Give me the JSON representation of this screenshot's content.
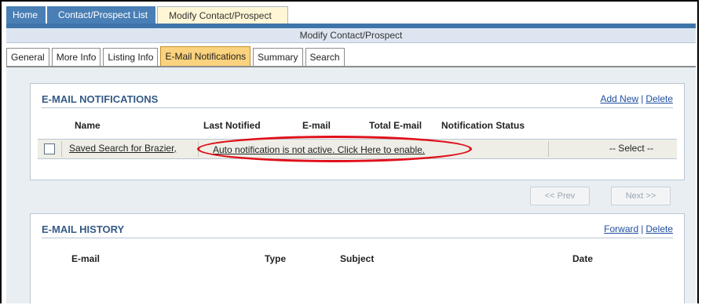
{
  "breadcrumbs": [
    {
      "label": "Home"
    },
    {
      "label": "Contact/Prospect List"
    },
    {
      "label": "Modify Contact/Prospect"
    }
  ],
  "section_title": "Modify Contact/Prospect",
  "tabs": [
    {
      "label": "General"
    },
    {
      "label": "More Info"
    },
    {
      "label": "Listing Info"
    },
    {
      "label": "E-Mail Notifications",
      "active": true
    },
    {
      "label": "Summary"
    },
    {
      "label": "Search"
    }
  ],
  "notifications": {
    "title": "E-MAIL NOTIFICATIONS",
    "add_new": "Add New",
    "separator": "|",
    "delete": "Delete",
    "columns": [
      "Name",
      "Last Notified",
      "E-mail",
      "Total E-mail",
      "Notification Status"
    ],
    "row": {
      "name": "Saved Search for Brazier,",
      "status_message": "Auto notification is not active. Click Here to enable.",
      "select_value": "-- Select --"
    }
  },
  "pager": {
    "prev": "<< Prev",
    "next": "Next >>"
  },
  "history": {
    "title": "E-MAIL HISTORY",
    "forward": "Forward",
    "separator": "|",
    "delete": "Delete",
    "columns": [
      "E-mail",
      "Type",
      "Subject",
      "Date"
    ]
  },
  "colors": {
    "tab_active": "#fbd27d",
    "nav_blue": "#4a7fb5",
    "highlight_oval": "#e0101a",
    "panel_title": "#355a86"
  }
}
